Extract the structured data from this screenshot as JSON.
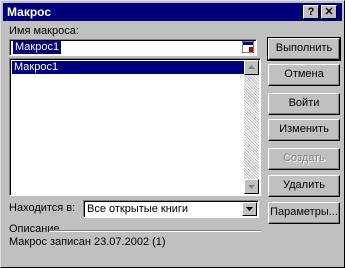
{
  "window": {
    "title": "Макрос"
  },
  "titlebar": {
    "help_label": "?",
    "close_label": "✕"
  },
  "macro_name": {
    "label": "Имя макроса:",
    "value": "Макрос1"
  },
  "macro_list": {
    "items": [
      "Макрос1"
    ]
  },
  "buttons": {
    "run": "Выполнить",
    "cancel": "Отмена",
    "step_into": "Войти",
    "edit": "Изменить",
    "create": "Создать",
    "delete": "Удалить",
    "options": "Параметры..."
  },
  "location": {
    "label": "Находится в:",
    "value": "Все открытые книги"
  },
  "description": {
    "label": "Описание",
    "text": "Макрос записан 23.07.2002 (1)"
  },
  "colors": {
    "titlebar": "#00007b",
    "selection": "#00007b",
    "face": "#c0c0c0"
  }
}
